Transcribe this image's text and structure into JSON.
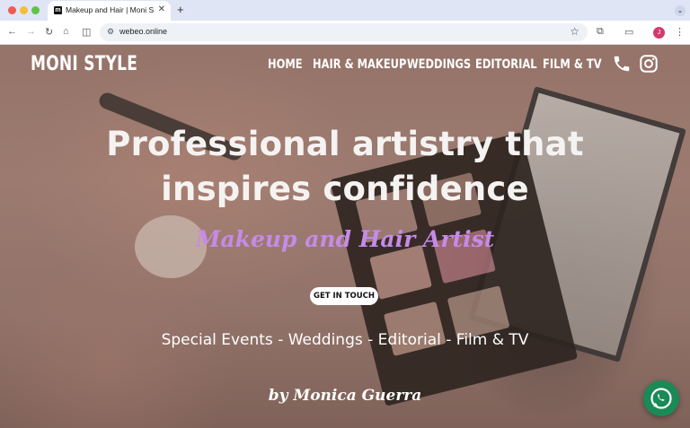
{
  "browser": {
    "tab_title": "Makeup and Hair | Moni Style",
    "tab_favicon_letter": "m",
    "url": "webeo.online",
    "profile_initial": "J"
  },
  "site": {
    "brand": "MONI STYLE",
    "nav": [
      "HOME",
      "HAIR & MAKEUP",
      "WEDDINGS",
      "EDITORIAL",
      "FILM & TV"
    ],
    "headline_line1": "Professional artistry that",
    "headline_line2": "inspires confidence",
    "subtitle": "Makeup and Hair Artist",
    "cta_label": "GET IN TOUCH",
    "services": "Special Events - Weddings -  Editorial - Film & TV",
    "byline": "by Monica Guerra",
    "icons": [
      "phone-icon",
      "instagram-icon",
      "whatsapp-icon"
    ]
  }
}
